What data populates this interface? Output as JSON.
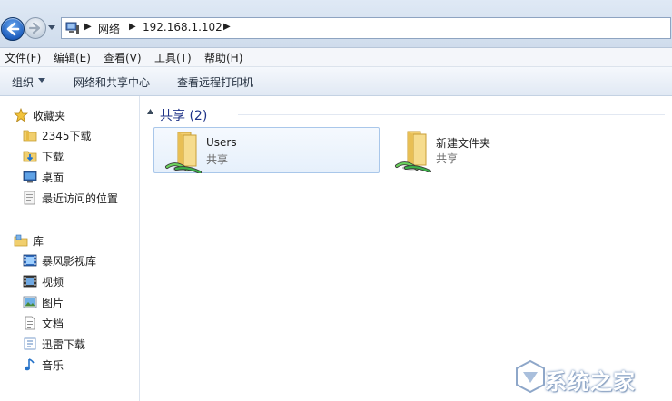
{
  "address_bar": {
    "crumbs": [
      "网络",
      "192.168.1.102"
    ]
  },
  "menu": {
    "items": [
      "文件(F)",
      "编辑(E)",
      "查看(V)",
      "工具(T)",
      "帮助(H)"
    ]
  },
  "command_bar": {
    "organize": "组织",
    "network_center": "网络和共享中心",
    "view_printers": "查看远程打印机"
  },
  "sidebar": {
    "favorites": {
      "label": "收藏夹",
      "icon": "star-icon",
      "items": [
        {
          "label": "2345下载",
          "icon": "folder-icon"
        },
        {
          "label": "下载",
          "icon": "download-folder-icon"
        },
        {
          "label": "桌面",
          "icon": "desktop-icon"
        },
        {
          "label": "最近访问的位置",
          "icon": "recent-places-icon"
        }
      ]
    },
    "libraries": {
      "label": "库",
      "icon": "library-icon",
      "items": [
        {
          "label": "暴风影视库",
          "icon": "video-library-icon"
        },
        {
          "label": "视频",
          "icon": "video-icon"
        },
        {
          "label": "图片",
          "icon": "picture-icon"
        },
        {
          "label": "文档",
          "icon": "document-icon"
        },
        {
          "label": "迅雷下载",
          "icon": "thunder-download-icon"
        },
        {
          "label": "音乐",
          "icon": "music-icon"
        }
      ]
    }
  },
  "content": {
    "group_title": "共享 (2)",
    "shares": [
      {
        "name": "Users",
        "type": "共享",
        "selected": true
      },
      {
        "name": "新建文件夹",
        "type": "共享",
        "selected": false
      }
    ]
  },
  "watermark": {
    "text": "系统之家"
  },
  "colors": {
    "accent_selection": "#e6f0fb",
    "group_title": "#1e3287",
    "toolbar_gradient_top": "#f5f8fc"
  }
}
